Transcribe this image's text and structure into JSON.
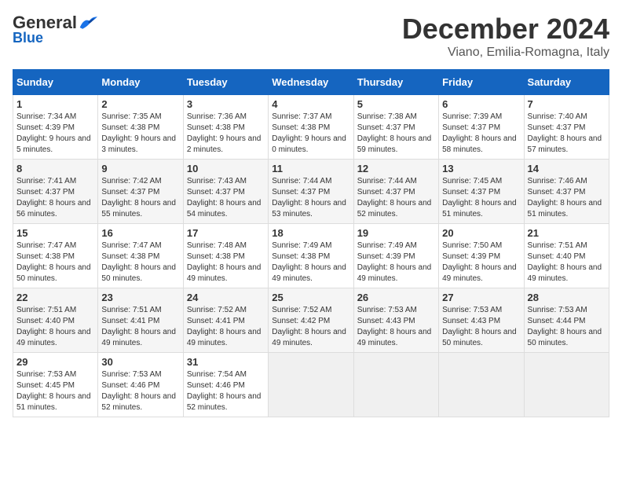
{
  "logo": {
    "general": "General",
    "blue": "Blue"
  },
  "title": "December 2024",
  "location": "Viano, Emilia-Romagna, Italy",
  "days_of_week": [
    "Sunday",
    "Monday",
    "Tuesday",
    "Wednesday",
    "Thursday",
    "Friday",
    "Saturday"
  ],
  "weeks": [
    [
      {
        "day": "1",
        "sunrise": "Sunrise: 7:34 AM",
        "sunset": "Sunset: 4:39 PM",
        "daylight": "Daylight: 9 hours and 5 minutes."
      },
      {
        "day": "2",
        "sunrise": "Sunrise: 7:35 AM",
        "sunset": "Sunset: 4:38 PM",
        "daylight": "Daylight: 9 hours and 3 minutes."
      },
      {
        "day": "3",
        "sunrise": "Sunrise: 7:36 AM",
        "sunset": "Sunset: 4:38 PM",
        "daylight": "Daylight: 9 hours and 2 minutes."
      },
      {
        "day": "4",
        "sunrise": "Sunrise: 7:37 AM",
        "sunset": "Sunset: 4:38 PM",
        "daylight": "Daylight: 9 hours and 0 minutes."
      },
      {
        "day": "5",
        "sunrise": "Sunrise: 7:38 AM",
        "sunset": "Sunset: 4:37 PM",
        "daylight": "Daylight: 8 hours and 59 minutes."
      },
      {
        "day": "6",
        "sunrise": "Sunrise: 7:39 AM",
        "sunset": "Sunset: 4:37 PM",
        "daylight": "Daylight: 8 hours and 58 minutes."
      },
      {
        "day": "7",
        "sunrise": "Sunrise: 7:40 AM",
        "sunset": "Sunset: 4:37 PM",
        "daylight": "Daylight: 8 hours and 57 minutes."
      }
    ],
    [
      {
        "day": "8",
        "sunrise": "Sunrise: 7:41 AM",
        "sunset": "Sunset: 4:37 PM",
        "daylight": "Daylight: 8 hours and 56 minutes."
      },
      {
        "day": "9",
        "sunrise": "Sunrise: 7:42 AM",
        "sunset": "Sunset: 4:37 PM",
        "daylight": "Daylight: 8 hours and 55 minutes."
      },
      {
        "day": "10",
        "sunrise": "Sunrise: 7:43 AM",
        "sunset": "Sunset: 4:37 PM",
        "daylight": "Daylight: 8 hours and 54 minutes."
      },
      {
        "day": "11",
        "sunrise": "Sunrise: 7:44 AM",
        "sunset": "Sunset: 4:37 PM",
        "daylight": "Daylight: 8 hours and 53 minutes."
      },
      {
        "day": "12",
        "sunrise": "Sunrise: 7:44 AM",
        "sunset": "Sunset: 4:37 PM",
        "daylight": "Daylight: 8 hours and 52 minutes."
      },
      {
        "day": "13",
        "sunrise": "Sunrise: 7:45 AM",
        "sunset": "Sunset: 4:37 PM",
        "daylight": "Daylight: 8 hours and 51 minutes."
      },
      {
        "day": "14",
        "sunrise": "Sunrise: 7:46 AM",
        "sunset": "Sunset: 4:37 PM",
        "daylight": "Daylight: 8 hours and 51 minutes."
      }
    ],
    [
      {
        "day": "15",
        "sunrise": "Sunrise: 7:47 AM",
        "sunset": "Sunset: 4:38 PM",
        "daylight": "Daylight: 8 hours and 50 minutes."
      },
      {
        "day": "16",
        "sunrise": "Sunrise: 7:47 AM",
        "sunset": "Sunset: 4:38 PM",
        "daylight": "Daylight: 8 hours and 50 minutes."
      },
      {
        "day": "17",
        "sunrise": "Sunrise: 7:48 AM",
        "sunset": "Sunset: 4:38 PM",
        "daylight": "Daylight: 8 hours and 49 minutes."
      },
      {
        "day": "18",
        "sunrise": "Sunrise: 7:49 AM",
        "sunset": "Sunset: 4:38 PM",
        "daylight": "Daylight: 8 hours and 49 minutes."
      },
      {
        "day": "19",
        "sunrise": "Sunrise: 7:49 AM",
        "sunset": "Sunset: 4:39 PM",
        "daylight": "Daylight: 8 hours and 49 minutes."
      },
      {
        "day": "20",
        "sunrise": "Sunrise: 7:50 AM",
        "sunset": "Sunset: 4:39 PM",
        "daylight": "Daylight: 8 hours and 49 minutes."
      },
      {
        "day": "21",
        "sunrise": "Sunrise: 7:51 AM",
        "sunset": "Sunset: 4:40 PM",
        "daylight": "Daylight: 8 hours and 49 minutes."
      }
    ],
    [
      {
        "day": "22",
        "sunrise": "Sunrise: 7:51 AM",
        "sunset": "Sunset: 4:40 PM",
        "daylight": "Daylight: 8 hours and 49 minutes."
      },
      {
        "day": "23",
        "sunrise": "Sunrise: 7:51 AM",
        "sunset": "Sunset: 4:41 PM",
        "daylight": "Daylight: 8 hours and 49 minutes."
      },
      {
        "day": "24",
        "sunrise": "Sunrise: 7:52 AM",
        "sunset": "Sunset: 4:41 PM",
        "daylight": "Daylight: 8 hours and 49 minutes."
      },
      {
        "day": "25",
        "sunrise": "Sunrise: 7:52 AM",
        "sunset": "Sunset: 4:42 PM",
        "daylight": "Daylight: 8 hours and 49 minutes."
      },
      {
        "day": "26",
        "sunrise": "Sunrise: 7:53 AM",
        "sunset": "Sunset: 4:43 PM",
        "daylight": "Daylight: 8 hours and 49 minutes."
      },
      {
        "day": "27",
        "sunrise": "Sunrise: 7:53 AM",
        "sunset": "Sunset: 4:43 PM",
        "daylight": "Daylight: 8 hours and 50 minutes."
      },
      {
        "day": "28",
        "sunrise": "Sunrise: 7:53 AM",
        "sunset": "Sunset: 4:44 PM",
        "daylight": "Daylight: 8 hours and 50 minutes."
      }
    ],
    [
      {
        "day": "29",
        "sunrise": "Sunrise: 7:53 AM",
        "sunset": "Sunset: 4:45 PM",
        "daylight": "Daylight: 8 hours and 51 minutes."
      },
      {
        "day": "30",
        "sunrise": "Sunrise: 7:53 AM",
        "sunset": "Sunset: 4:46 PM",
        "daylight": "Daylight: 8 hours and 52 minutes."
      },
      {
        "day": "31",
        "sunrise": "Sunrise: 7:54 AM",
        "sunset": "Sunset: 4:46 PM",
        "daylight": "Daylight: 8 hours and 52 minutes."
      },
      null,
      null,
      null,
      null
    ]
  ]
}
